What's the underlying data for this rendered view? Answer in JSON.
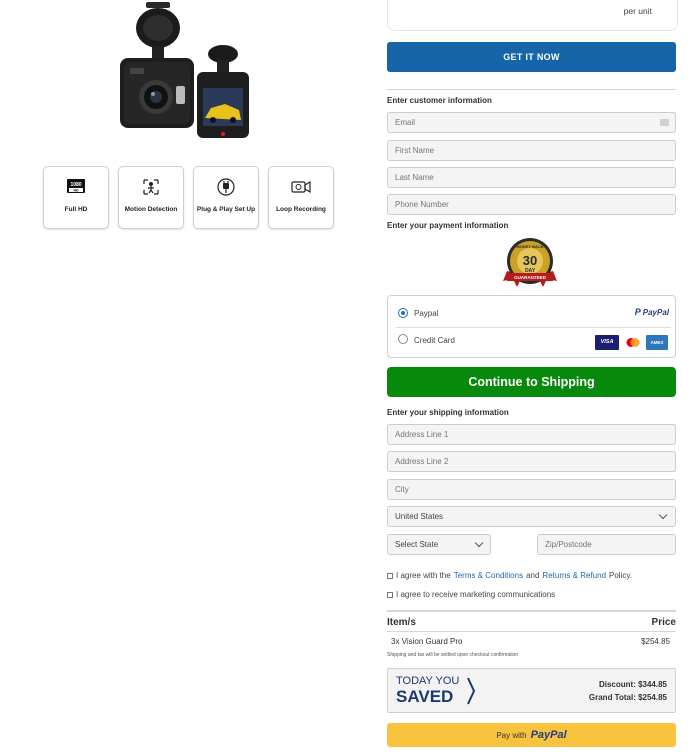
{
  "product": {
    "features": [
      {
        "icon": "full-hd-icon",
        "label": "Full HD",
        "badge_top": "1080",
        "badge_bottom": "HD"
      },
      {
        "icon": "motion-detection-icon",
        "label": "Motion Detection"
      },
      {
        "icon": "plug-and-play-icon",
        "label": "Plug & Play Set Up"
      },
      {
        "icon": "loop-recording-icon",
        "label": "Loop Recording"
      }
    ]
  },
  "top_card": {
    "per_unit": "per unit"
  },
  "get_button": "GET IT NOW",
  "customer": {
    "heading": "Enter customer information",
    "email_placeholder": "Email",
    "first_name_placeholder": "First Name",
    "last_name_placeholder": "Last Name",
    "phone_placeholder": "Phone Number"
  },
  "payment": {
    "heading": "Enter your payment information",
    "seal": {
      "top": "MONEY BACK",
      "number": "30",
      "day": "DAY",
      "bottom": "GUARANTEED"
    },
    "options": [
      {
        "label": "Paypal",
        "selected": true,
        "logo": "PayPal"
      },
      {
        "label": "Credit Card",
        "selected": false,
        "cards": [
          "VISA",
          "mastercard",
          "AMEX"
        ]
      }
    ]
  },
  "continue_button": "Continue to Shipping",
  "shipping": {
    "heading": "Enter your shipping information",
    "address1_placeholder": "Address Line 1",
    "address2_placeholder": "Address Line 2",
    "city_placeholder": "City",
    "country": "United States",
    "state": "Select State",
    "zip_placeholder": "Zip/Postcode"
  },
  "agreements": {
    "terms_prefix": "I agree with the",
    "terms_link": "Terms & Conditions",
    "and": "and",
    "refund_link": "Returns & Refund",
    "terms_suffix": "Policy.",
    "marketing": "I agree to receive marketing communications"
  },
  "order": {
    "col_item": "Item/s",
    "col_price": "Price",
    "items": [
      {
        "name": "3x Vision Guard Pro",
        "price": "$254.85"
      }
    ],
    "note": "Shipping and tax will be settled upon checkout confirmation",
    "saved_line1": "TODAY YOU",
    "saved_line2": "SAVED",
    "discount": "Discount: $344.85",
    "grand_total": "Grand Total: $254.85"
  },
  "paypal_button": {
    "prefix": "Pay with",
    "logo": "PayPal"
  },
  "colors": {
    "primary_blue": "#1565a8",
    "continue_green": "#078a0b",
    "paypal_yellow": "#f8c33e",
    "saved_navy": "#1d3a6e"
  }
}
